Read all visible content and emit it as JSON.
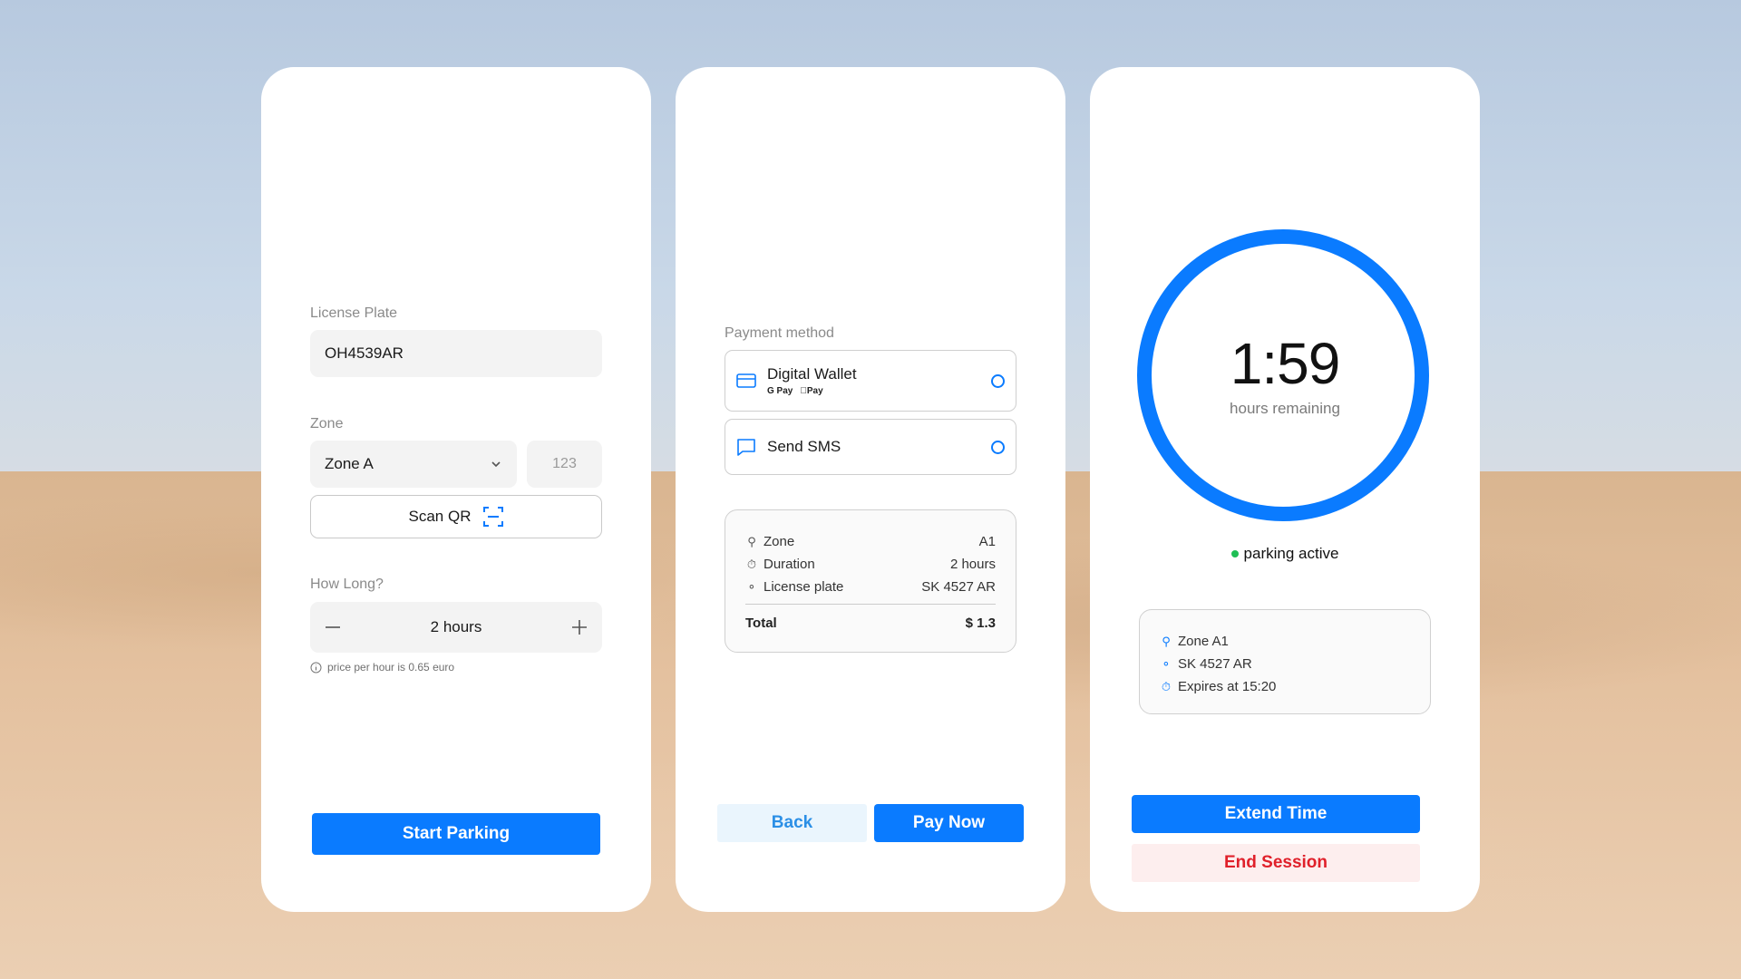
{
  "colors": {
    "accent": "#0a7bff",
    "danger": "#e0202a",
    "active": "#1fbf55"
  },
  "setup": {
    "plate_label": "License Plate",
    "plate_value": "OH4539AR",
    "zone_label": "Zone",
    "zone_value": "Zone A",
    "zone_code_placeholder": "123",
    "scan_label": "Scan QR",
    "howlong_label": "How Long?",
    "duration_value": "2 hours",
    "price_note": "price per hour is 0.65 euro",
    "start_label": "Start Parking"
  },
  "payment": {
    "method_label": "Payment method",
    "options": [
      {
        "title": "Digital Wallet",
        "sub": [
          "G Pay",
          "Pay"
        ],
        "icon": "card-icon"
      },
      {
        "title": "Send SMS",
        "icon": "chat-icon"
      }
    ],
    "summary": {
      "rows": [
        {
          "label": "Zone",
          "value": "A1",
          "icon": "location-pin-icon"
        },
        {
          "label": "Duration",
          "value": "2 hours",
          "icon": "stopwatch-icon"
        },
        {
          "label": "License plate",
          "value": "SK 4527 AR",
          "icon": "car-icon"
        }
      ],
      "total_label": "Total",
      "total_value": "$ 1.3"
    },
    "back_label": "Back",
    "pay_label": "Pay Now"
  },
  "session": {
    "timer": "1:59",
    "timer_caption": "hours remaining",
    "status": "parking active",
    "info": [
      {
        "text": "Zone A1",
        "icon": "location-pin-icon"
      },
      {
        "text": "SK 4527 AR",
        "icon": "car-icon"
      },
      {
        "text": "Expires at 15:20",
        "icon": "stopwatch-icon"
      }
    ],
    "extend_label": "Extend Time",
    "end_label": "End Session"
  }
}
